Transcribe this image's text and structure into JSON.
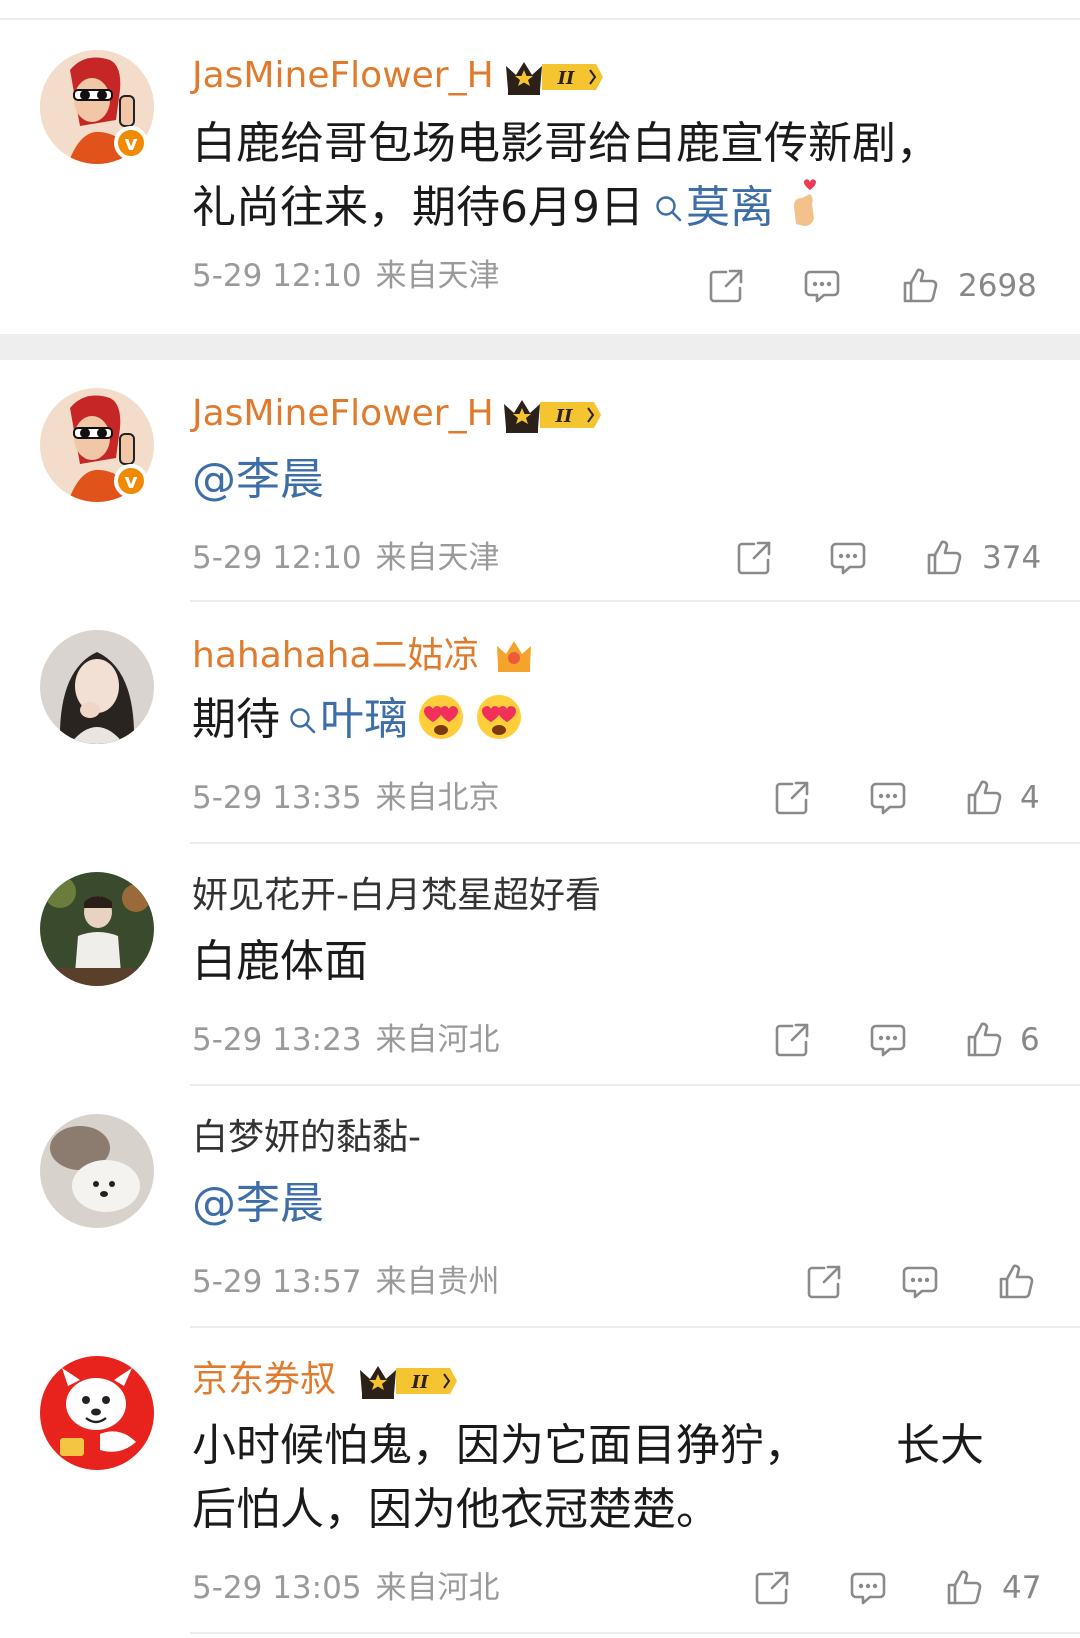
{
  "comments": [
    {
      "username": "JasMineFlower_H",
      "text_line1": "白鹿给哥包场电影哥给白鹿宣传新剧，",
      "text_line2_pre": "礼尚往来，期待6月9日",
      "topic": "莫离",
      "time": "5-29 12:10",
      "location": "来自天津",
      "likes": "2698"
    },
    {
      "username": "JasMineFlower_H",
      "mention": "@李晨",
      "time": "5-29 12:10",
      "location": "来自天津",
      "likes": "374"
    },
    {
      "username": "hahahaha二姑凉",
      "text_pre": "期待",
      "topic": "叶璃",
      "time": "5-29 13:35",
      "location": "来自北京",
      "likes": "4"
    },
    {
      "username": "妍见花开-白月梵星超好看",
      "text": "白鹿体面",
      "time": "5-29 13:23",
      "location": "来自河北",
      "likes": "6"
    },
    {
      "username": "白梦妍的黏黏-",
      "mention": "@李晨",
      "time": "5-29 13:57",
      "location": "来自贵州",
      "likes": ""
    },
    {
      "username": "京东券叔",
      "text_line1_a": "小时候怕鬼，因为它面目狰狞，",
      "text_line1_b": "长大",
      "text_line2": "后怕人，因为他衣冠楚楚。",
      "time": "5-29 13:05",
      "location": "来自河北",
      "likes": "47"
    }
  ],
  "badges": {
    "crown_level": "II"
  },
  "colors": {
    "vip_name": "#e07a2c",
    "link": "#3d6ea8",
    "meta": "#9a9a9a"
  }
}
